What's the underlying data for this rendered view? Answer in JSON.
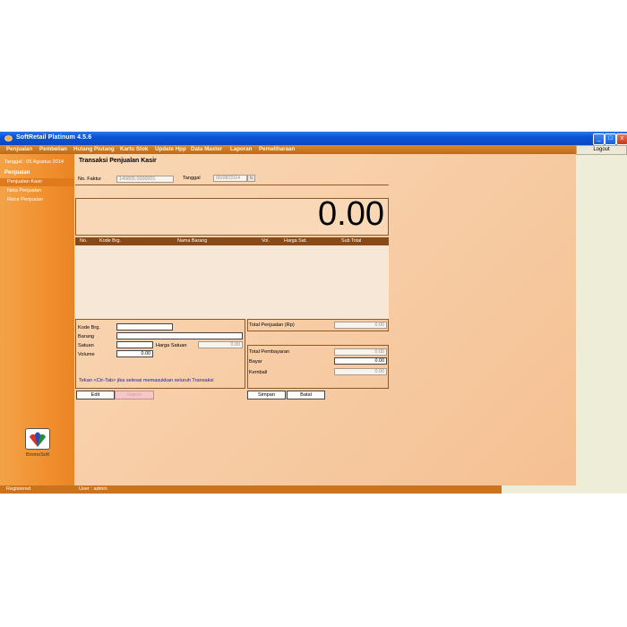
{
  "window": {
    "title": "SoftRetail Platinum 4.5.6",
    "min_label": "_",
    "max_label": "□",
    "close_label": "x"
  },
  "menu": [
    "Penjualan",
    "Pembelian",
    "Hutang Piutang",
    "Kartu Stok",
    "Update Hpp",
    "Data Master",
    "Laporan",
    "Pemeliharaan"
  ],
  "logout_label": "Logout",
  "sidebar": {
    "date": "Tanggal : 05 Agustus 2014",
    "section": "Penjualan",
    "items": [
      "Penjualan Kasir",
      "Nota Penjualan",
      "Retur Penjualan"
    ],
    "logo_label": "BromoSoft"
  },
  "form": {
    "title": "Transaksi Penjualan Kasir",
    "no_faktur_label": "No. Faktur",
    "no_faktur_value": "140805.0000001",
    "tanggal_label": "Tanggal",
    "tanggal_value": "05/08/2014"
  },
  "display": {
    "total": "0.00"
  },
  "grid": {
    "columns": [
      "No.",
      "Kode Brg.",
      "Nama Barang",
      "Vol.",
      "Harga Sat.",
      "Sub Total"
    ]
  },
  "entry": {
    "kode_label": "Kode Brg.",
    "kode_value": "",
    "barang_label": "Barang",
    "barang_value": "",
    "satuan_label": "Satuan",
    "satuan_value": "",
    "harga_satuan_label": "Harga Satuan",
    "harga_satuan_value": "0.00",
    "volume_label": "Volume",
    "volume_value": "0.00",
    "hint": "Tekan <Ctr-Tab> jika selesai memasukkan seluruh Transaksi"
  },
  "totals": {
    "total_penjualan_label": "Total Penjualan (Rp)",
    "total_penjualan_value": "0.00",
    "total_pembayaran_label": "Total Pembayaran",
    "total_pembayaran_value": "0.00",
    "bayar_label": "Bayar",
    "bayar_value": "0.00",
    "kembali_label": "Kembali",
    "kembali_value": "0.00"
  },
  "buttons": {
    "edit": "Edit",
    "hapus": "Hapus",
    "simpan": "Simpan",
    "batal": "Batal"
  },
  "status": {
    "left": "Registered",
    "user": "User : admin"
  },
  "colors": {
    "accent": "#f08d2c",
    "menu": "#c06a18",
    "grid_header": "#8a4a18",
    "hint_text": "#1a1aa0"
  }
}
